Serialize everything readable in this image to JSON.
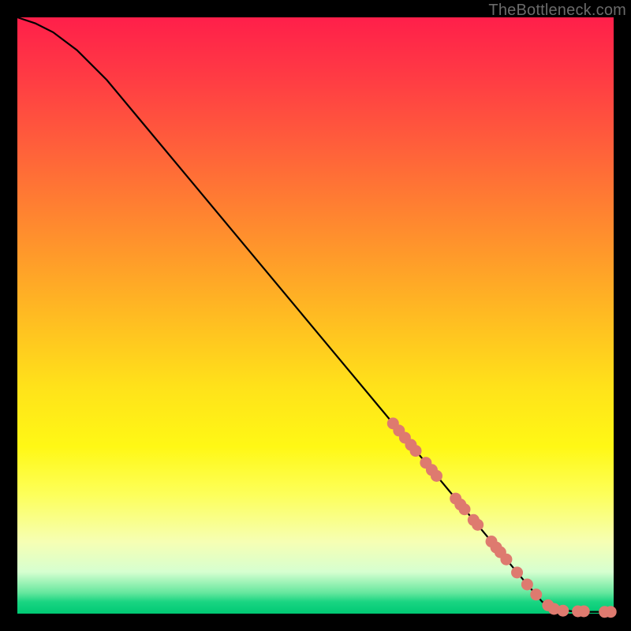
{
  "attribution": "TheBottleneck.com",
  "chart_data": {
    "type": "line",
    "title": "",
    "xlabel": "",
    "ylabel": "",
    "xlim": [
      0,
      100
    ],
    "ylim": [
      0,
      100
    ],
    "grid": false,
    "legend": false,
    "description": "Monotone decreasing bottleneck curve from top-left to bottom-right with flat tail near x≈90–100, y≈0.",
    "curve_points": [
      {
        "x": 0,
        "y": 100.0
      },
      {
        "x": 3,
        "y": 99.0
      },
      {
        "x": 6,
        "y": 97.5
      },
      {
        "x": 10,
        "y": 94.5
      },
      {
        "x": 15,
        "y": 89.5
      },
      {
        "x": 20,
        "y": 83.5
      },
      {
        "x": 30,
        "y": 71.5
      },
      {
        "x": 40,
        "y": 59.5
      },
      {
        "x": 50,
        "y": 47.5
      },
      {
        "x": 60,
        "y": 35.5
      },
      {
        "x": 70,
        "y": 23.5
      },
      {
        "x": 80,
        "y": 11.5
      },
      {
        "x": 85,
        "y": 5.5
      },
      {
        "x": 88,
        "y": 2.0
      },
      {
        "x": 90,
        "y": 0.8
      },
      {
        "x": 93,
        "y": 0.4
      },
      {
        "x": 96,
        "y": 0.3
      },
      {
        "x": 100,
        "y": 0.3
      }
    ],
    "markers": [
      {
        "x": 63.0,
        "y": 31.9
      },
      {
        "x": 64.0,
        "y": 30.7
      },
      {
        "x": 65.0,
        "y": 29.5
      },
      {
        "x": 66.0,
        "y": 28.3
      },
      {
        "x": 66.8,
        "y": 27.3
      },
      {
        "x": 68.5,
        "y": 25.3
      },
      {
        "x": 69.5,
        "y": 24.1
      },
      {
        "x": 70.3,
        "y": 23.1
      },
      {
        "x": 73.5,
        "y": 19.3
      },
      {
        "x": 74.3,
        "y": 18.3
      },
      {
        "x": 75.0,
        "y": 17.5
      },
      {
        "x": 76.5,
        "y": 15.7
      },
      {
        "x": 77.2,
        "y": 14.9
      },
      {
        "x": 79.5,
        "y": 12.1
      },
      {
        "x": 80.3,
        "y": 11.1
      },
      {
        "x": 81.0,
        "y": 10.3
      },
      {
        "x": 82.0,
        "y": 9.1
      },
      {
        "x": 83.8,
        "y": 6.9
      },
      {
        "x": 85.5,
        "y": 4.9
      },
      {
        "x": 87.0,
        "y": 3.2
      },
      {
        "x": 89.0,
        "y": 1.4
      },
      {
        "x": 90.0,
        "y": 0.8
      },
      {
        "x": 91.5,
        "y": 0.5
      },
      {
        "x": 94.0,
        "y": 0.4
      },
      {
        "x": 95.0,
        "y": 0.4
      },
      {
        "x": 98.5,
        "y": 0.3
      },
      {
        "x": 99.5,
        "y": 0.3
      }
    ],
    "marker_color": "#de7a6f",
    "marker_radius_px": 7.5
  },
  "colors": {
    "frame_bg": "#000000",
    "attribution_text": "#6a6a6a",
    "curve_stroke": "#000000"
  }
}
